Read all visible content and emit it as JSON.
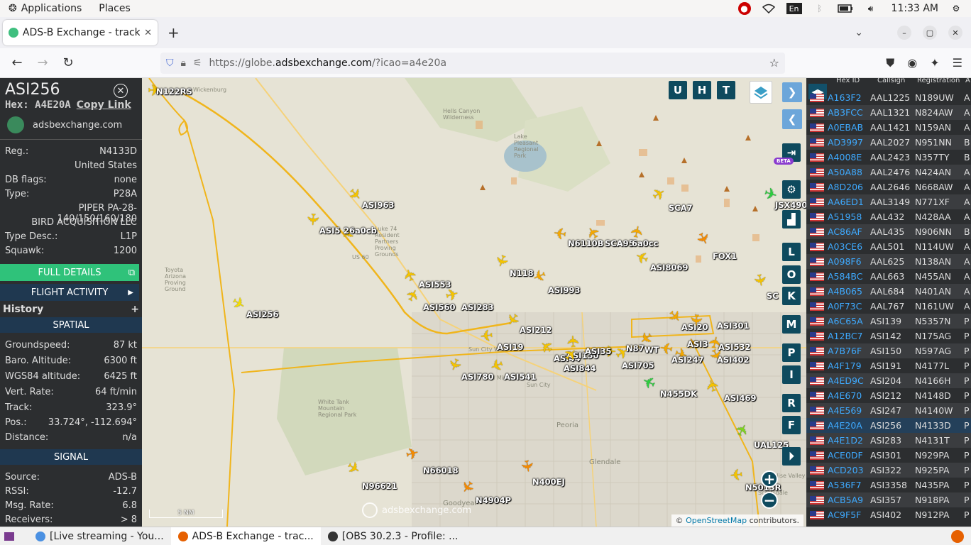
{
  "topbar": {
    "applications": "Applications",
    "places": "Places",
    "clock": "11:33 AM",
    "lang": "En"
  },
  "browser": {
    "tab_title": "ADS-B Exchange - track a",
    "url_prefix": "https://globe.",
    "url_domain": "adsbexchange.com",
    "url_path": "/?icao=a4e20a"
  },
  "info": {
    "callsign": "ASI256",
    "hex_label": "Hex:",
    "hex": "A4E20A",
    "copy_link": "Copy Link",
    "site": "adsbexchange.com",
    "reg_label": "Reg.:",
    "reg": "N4133D",
    "country": "United States",
    "dbflags_label": "DB flags:",
    "dbflags": "none",
    "type_label": "Type:",
    "type": "P28A",
    "model": "PIPER PA-28-140/150/160/180",
    "owner": "BIRD ACQUISITION LLC",
    "typedesc_label": "Type Desc.:",
    "typedesc": "L1P",
    "squawk_label": "Squawk:",
    "squawk": "1200",
    "full_details": "FULL DETAILS",
    "flight_activity": "FLIGHT ACTIVITY",
    "history": "History",
    "spatial": "SPATIAL",
    "gs_label": "Groundspeed:",
    "gs": "87 kt",
    "baro_label": "Baro. Altitude:",
    "baro": "6300 ft",
    "wgs_label": "WGS84 altitude:",
    "wgs": "6425 ft",
    "vr_label": "Vert. Rate:",
    "vr": "64 ft/min",
    "track_label": "Track:",
    "track": "323.9°",
    "pos_label": "Pos.:",
    "pos": "33.724°, -112.694°",
    "dist_label": "Distance:",
    "dist": "n/a",
    "signal": "SIGNAL",
    "source_label": "Source:",
    "source": "ADS-B",
    "rssi_label": "RSSI:",
    "rssi": "-12.7",
    "msgrate_label": "Msg. Rate:",
    "msgrate": "6.8",
    "receivers_label": "Receivers:",
    "receivers": "> 8"
  },
  "map": {
    "scale": "5 NM",
    "watermark": "adsbexchange.com",
    "attrib_osm": "OpenStreetMap",
    "attrib_rest": " contributors.",
    "btns_top": [
      "U",
      "H",
      "T"
    ],
    "btns_side": [
      "L",
      "O",
      "K",
      "M",
      "P",
      "I",
      "R",
      "F"
    ],
    "beta": "BETA",
    "place_labels": [
      "Wickenburg",
      "Hells Canyon Wilderness",
      "Lake Pleasant Regional Park",
      "Luke 74 Resident Partners Proving Grounds",
      "Toyota Arizona Proving Ground",
      "Sun City West",
      "Sun City",
      "El Mirage",
      "White Tank Mountain Regional Park",
      "Peoria",
      "Glendale",
      "Goodyear",
      "Paradise Valley",
      "Scottsdale",
      "US 60"
    ],
    "planes": [
      {
        "label": "N122RS",
        "color": "#f5c400"
      },
      {
        "label": "ASI963",
        "color": "#f5c400"
      },
      {
        "label": "ASI5",
        "color": "#f5c400"
      },
      {
        "label": "26a0cb",
        "color": "#f5c400"
      },
      {
        "label": "N6110B",
        "color": "#f5a800"
      },
      {
        "label": "SCA95",
        "color": "#f5a800"
      },
      {
        "label": "6a0cc",
        "color": "#f5a800"
      },
      {
        "label": "SCA7",
        "color": "#f5c400"
      },
      {
        "label": "JSX490",
        "color": "#2ecc40"
      },
      {
        "label": "FOX1",
        "color": "#f58a00"
      },
      {
        "label": "N118",
        "color": "#f5c400"
      },
      {
        "label": "ASI993",
        "color": "#f5a800"
      },
      {
        "label": "ASI8069",
        "color": "#f5c400"
      },
      {
        "label": "ASI553",
        "color": "#f5c400"
      },
      {
        "label": "ASI560",
        "color": "#f5c400"
      },
      {
        "label": "ASI283",
        "color": "#f5c400"
      },
      {
        "label": "ASI256",
        "color": "#f5e000"
      },
      {
        "label": "SC",
        "color": "#f5c400"
      },
      {
        "label": "ASI212",
        "color": "#f5c400"
      },
      {
        "label": "ASI19",
        "color": "#f5c400"
      },
      {
        "label": "ASI44",
        "color": "#f5c400"
      },
      {
        "label": "ASI150",
        "color": "#f5c400"
      },
      {
        "label": "ASI844",
        "color": "#f5c400"
      },
      {
        "label": "ASI35",
        "color": "#f5c400"
      },
      {
        "label": "ASI20",
        "color": "#f5a800"
      },
      {
        "label": "ASI301",
        "color": "#f5a800"
      },
      {
        "label": "N87",
        "color": "#f5a800"
      },
      {
        "label": "WT",
        "color": "#f5a800"
      },
      {
        "label": "ASI3",
        "color": "#f5a800"
      },
      {
        "label": "ASI532",
        "color": "#f5a800"
      },
      {
        "label": "ASI705",
        "color": "#f5c400"
      },
      {
        "label": "ASI247",
        "color": "#f5a800"
      },
      {
        "label": "ASI402",
        "color": "#f5a800"
      },
      {
        "label": "ASI780",
        "color": "#f5c400"
      },
      {
        "label": "ASI541",
        "color": "#f5c400"
      },
      {
        "label": "N455DK",
        "color": "#2ecc40"
      },
      {
        "label": "ASI469",
        "color": "#f5c400"
      },
      {
        "label": "UAL125",
        "color": "#7ed321"
      },
      {
        "label": "N66018",
        "color": "#f58a00"
      },
      {
        "label": "N96621",
        "color": "#f5c400"
      },
      {
        "label": "N400EJ",
        "color": "#f58a00"
      },
      {
        "label": "N4904P",
        "color": "#f58a00"
      },
      {
        "label": "N5013R",
        "color": "#f5c400"
      }
    ]
  },
  "table": {
    "headers": [
      "Hex ID",
      "Callsign",
      "Registration",
      "A"
    ],
    "rows": [
      [
        "A163F2",
        "AAL1225",
        "N189UW",
        "A"
      ],
      [
        "AB3FCC",
        "AAL1321",
        "N824AW",
        "A"
      ],
      [
        "A0EBAB",
        "AAL1421",
        "N159AN",
        "A"
      ],
      [
        "AD3997",
        "AAL2027",
        "N951NN",
        "B"
      ],
      [
        "A4008E",
        "AAL2423",
        "N357TY",
        "B"
      ],
      [
        "A50A88",
        "AAL2476",
        "N424AN",
        "A"
      ],
      [
        "A8D206",
        "AAL2646",
        "N668AW",
        "A"
      ],
      [
        "AA6ED1",
        "AAL3149",
        "N771XF",
        "A"
      ],
      [
        "A51958",
        "AAL432",
        "N428AA",
        "A"
      ],
      [
        "AC86AF",
        "AAL435",
        "N906NN",
        "B"
      ],
      [
        "A03CE6",
        "AAL501",
        "N114UW",
        "A"
      ],
      [
        "A098F6",
        "AAL625",
        "N138AN",
        "A"
      ],
      [
        "A584BC",
        "AAL663",
        "N455AN",
        "A"
      ],
      [
        "A4B065",
        "AAL684",
        "N401AN",
        "A"
      ],
      [
        "A0F73C",
        "AAL767",
        "N161UW",
        "A"
      ],
      [
        "A6C65A",
        "ASI139",
        "N5357N",
        "P"
      ],
      [
        "A12BC7",
        "ASI142",
        "N175AG",
        "P"
      ],
      [
        "A7B76F",
        "ASI150",
        "N597AG",
        "P"
      ],
      [
        "A4F179",
        "ASI191",
        "N4177L",
        "P"
      ],
      [
        "A4ED9C",
        "ASI204",
        "N4166H",
        "P"
      ],
      [
        "A4E670",
        "ASI212",
        "N4148D",
        "P"
      ],
      [
        "A4E569",
        "ASI247",
        "N4140W",
        "P"
      ],
      [
        "A4E20A",
        "ASI256",
        "N4133D",
        "P"
      ],
      [
        "A4E1D2",
        "ASI283",
        "N4131T",
        "P"
      ],
      [
        "ACE0DF",
        "ASI301",
        "N929PA",
        "P"
      ],
      [
        "ACD203",
        "ASI322",
        "N925PA",
        "P"
      ],
      [
        "A536F7",
        "ASI3358",
        "N435PA",
        "P"
      ],
      [
        "ACB5A9",
        "ASI357",
        "N918PA",
        "P"
      ],
      [
        "AC9F5F",
        "ASI402",
        "N912PA",
        "P"
      ]
    ]
  },
  "taskbar": {
    "items": [
      "[Live streaming - You...",
      "ADS-B Exchange - trac...",
      "[OBS 30.2.3 - Profile: ..."
    ]
  }
}
